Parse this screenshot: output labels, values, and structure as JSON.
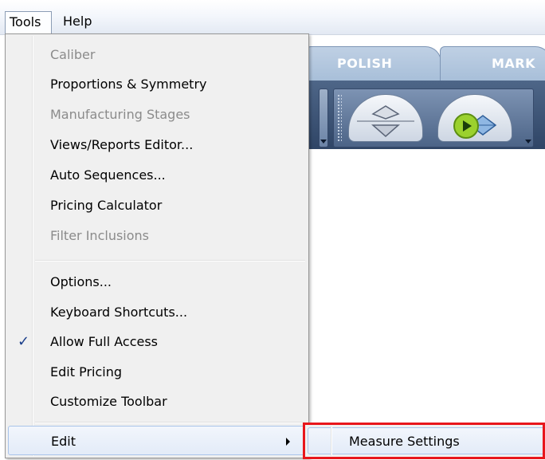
{
  "menubar": {
    "tools_label": "Tools",
    "help_label": "Help"
  },
  "tabs": [
    {
      "label": "POLISH"
    },
    {
      "label": "MARK"
    }
  ],
  "toolbar": {
    "icons": [
      "diamond-view-icon",
      "play-diamond-icon"
    ]
  },
  "tools_menu": {
    "items": [
      {
        "label": "Caliber",
        "enabled": false
      },
      {
        "label": "Proportions & Symmetry",
        "enabled": true
      },
      {
        "label": "Manufacturing Stages",
        "enabled": false
      },
      {
        "label": "Views/Reports Editor...",
        "enabled": true
      },
      {
        "label": "Auto Sequences...",
        "enabled": true
      },
      {
        "label": "Pricing Calculator",
        "enabled": true
      },
      {
        "label": "Filter Inclusions",
        "enabled": false
      },
      {
        "label": "Options...",
        "enabled": true
      },
      {
        "label": "Keyboard Shortcuts...",
        "enabled": true
      },
      {
        "label": "Allow Full Access",
        "enabled": true,
        "checked": true,
        "check_mark": "✓"
      },
      {
        "label": "Edit Pricing",
        "enabled": true
      },
      {
        "label": "Customize Toolbar",
        "enabled": true
      },
      {
        "label": "Edit",
        "enabled": true,
        "has_submenu": true
      }
    ]
  },
  "edit_submenu": {
    "items": [
      {
        "label": "Measure Settings"
      }
    ]
  },
  "colors": {
    "highlight_frame": "#e8161b",
    "disabled_text": "#8b8b8b",
    "toolbar_bg": "#2f4566"
  }
}
